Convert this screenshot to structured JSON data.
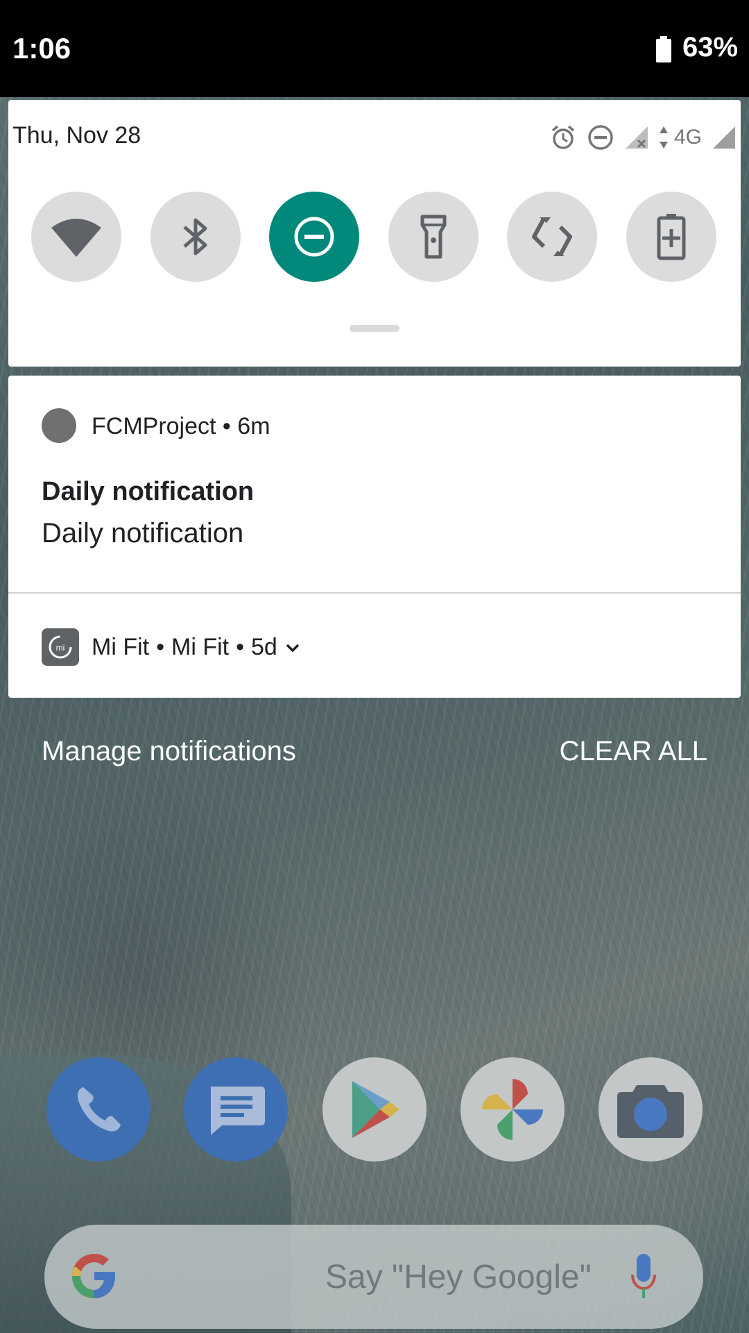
{
  "status_bar": {
    "time": "1:06",
    "battery": "63%"
  },
  "quick_settings": {
    "date": "Thu, Nov 28",
    "network_label": "4G",
    "status_icons": [
      "alarm-icon",
      "dnd-icon",
      "signal-x-icon",
      "signal-icon"
    ],
    "tiles": [
      {
        "name": "wifi",
        "icon": "wifi-icon",
        "active": false
      },
      {
        "name": "bluetooth",
        "icon": "bluetooth-icon",
        "active": false
      },
      {
        "name": "do-not-disturb",
        "icon": "dnd-icon",
        "active": true
      },
      {
        "name": "flashlight",
        "icon": "flashlight-icon",
        "active": false
      },
      {
        "name": "auto-rotate",
        "icon": "rotate-icon",
        "active": false
      },
      {
        "name": "battery-saver",
        "icon": "battery-saver-icon",
        "active": false
      }
    ],
    "accent_color": "#00897b"
  },
  "notifications": [
    {
      "app": "FCMProject",
      "time": "6m",
      "title": "Daily notification",
      "text": "Daily notification"
    },
    {
      "app": "Mi Fit",
      "channel": "Mi Fit",
      "time": "5d"
    }
  ],
  "actions": {
    "manage": "Manage notifications",
    "clear": "CLEAR ALL"
  },
  "dock": {
    "apps": [
      "phone-icon",
      "messages-icon",
      "play-store-icon",
      "photos-icon",
      "camera-icon"
    ]
  },
  "search": {
    "hint": "Say \"Hey Google\""
  }
}
